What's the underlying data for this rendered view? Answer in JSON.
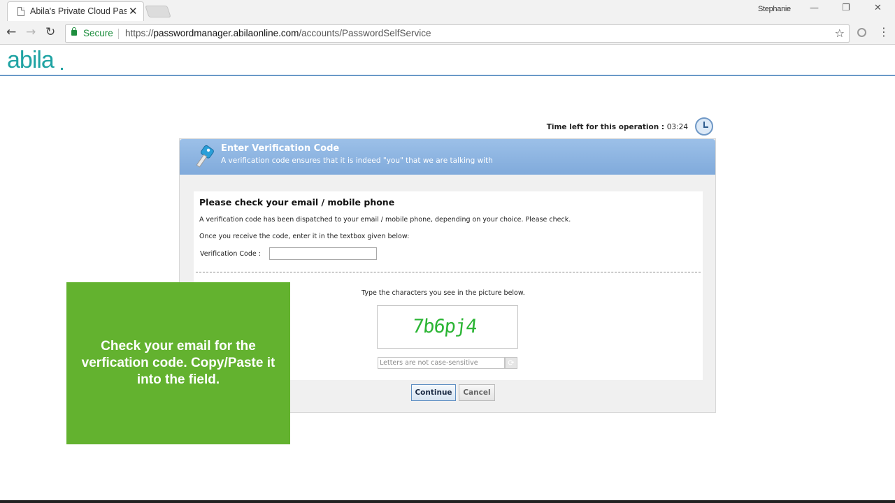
{
  "browser": {
    "tab_title": "Abila's Private Cloud Pas",
    "tab_close": "✕",
    "profile_name": "Stephanie",
    "minimize": "—",
    "restore": "❐",
    "close": "✕",
    "back": "←",
    "forward": "→",
    "reload": "↻",
    "secure_label": "Secure",
    "url_scheme": "https://",
    "url_host": "passwordmanager.abilaonline.com",
    "url_path": "/accounts/PasswordSelfService",
    "bookmark": "☆",
    "menu": "⋮"
  },
  "site": {
    "logo_text": "abila",
    "logo_color": "#1fa3a3"
  },
  "timer": {
    "label": "Time left for this operation :",
    "value": "03:24"
  },
  "panel": {
    "title": "Enter Verification Code",
    "subtitle": "A verification code ensures that it is indeed \"you\" that we are talking with",
    "header_color": "#80aadb"
  },
  "form": {
    "heading": "Please check your email / mobile phone",
    "line1": "A verification code has been dispatched to your email / mobile phone, depending on your choice. Please check.",
    "line2": "Once you receive the code, enter it in the textbox given below:",
    "code_label": "Verification Code :",
    "code_value": "",
    "captcha_instruction": "Type the characters you see in the picture below.",
    "captcha_text": "7b6pj4",
    "captcha_placeholder": "Letters are not case-sensitive",
    "refresh_icon": "⟳",
    "continue_label": "Continue",
    "cancel_label": "Cancel"
  },
  "callout": {
    "text": "Check your email for the verfication code. Copy/Paste it into the field.",
    "color": "#63b22f"
  }
}
